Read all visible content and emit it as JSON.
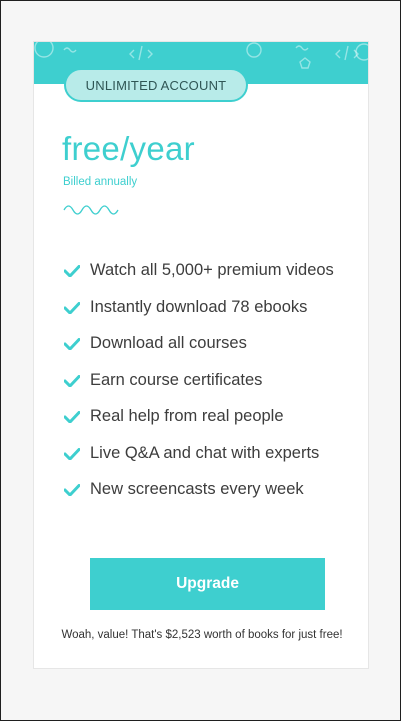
{
  "plan": {
    "badge_label": "UNLIMITED ACCOUNT",
    "price": "free/year",
    "billing": "Billed annually"
  },
  "features": [
    "Watch all 5,000+ premium videos",
    "Instantly download 78 ebooks",
    "Download all courses",
    "Earn course certificates",
    "Real help from real people",
    "Live Q&A and chat with experts",
    "New screencasts every week"
  ],
  "cta": {
    "button_label": "Upgrade",
    "note": "Woah, value! That's $2,523 worth of books for just free!"
  },
  "colors": {
    "accent": "#3ecfcf",
    "badge_fill": "#b8ebe9",
    "text": "#3d3d3d",
    "page_bg": "#f6f6f6"
  },
  "icons": {
    "feature_bullet": "check-icon",
    "header_decorations": [
      "circle-icon",
      "code-brackets-icon",
      "squiggle-icon",
      "pentagon-icon"
    ]
  }
}
